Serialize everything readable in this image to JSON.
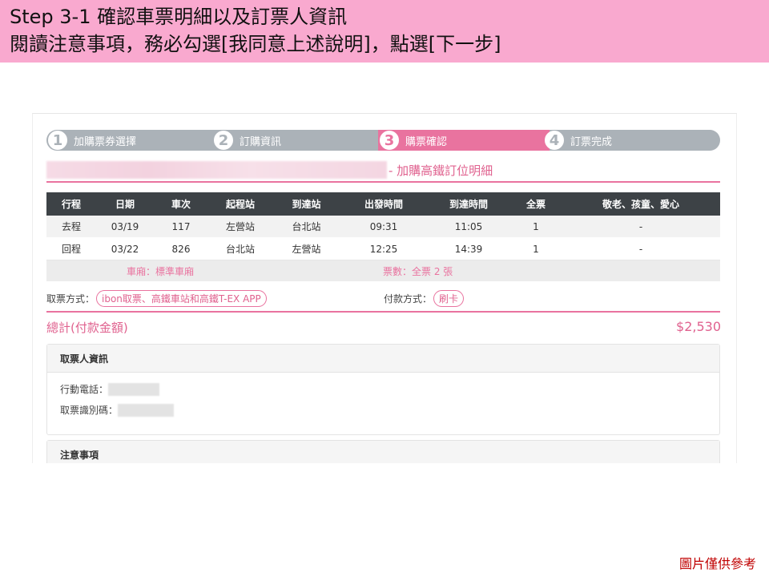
{
  "banner": {
    "line1": "Step 3-1 確認車票明細以及訂票人資訊",
    "line2": "閱讀注意事項，務必勾選[我同意上述說明]，點選[下一步]"
  },
  "stepper": [
    {
      "num": "1",
      "label": "加購票券選擇"
    },
    {
      "num": "2",
      "label": "訂購資訊"
    },
    {
      "num": "3",
      "label": "購票確認"
    },
    {
      "num": "4",
      "label": "訂票完成"
    }
  ],
  "section_title": "- 加購高鐵訂位明細",
  "table": {
    "headers": [
      "行程",
      "日期",
      "車次",
      "起程站",
      "到達站",
      "出發時間",
      "到達時間",
      "全票",
      "敬老、孩童、愛心"
    ],
    "rows": [
      [
        "去程",
        "03/19",
        "117",
        "左營站",
        "台北站",
        "09:31",
        "11:05",
        "1",
        "-"
      ],
      [
        "回程",
        "03/22",
        "826",
        "台北站",
        "左營站",
        "12:25",
        "14:39",
        "1",
        "-"
      ]
    ],
    "car_type": "車廂：標準車廂",
    "ticket_count": "票數：全票 2 張"
  },
  "pickup": {
    "label": "取票方式：",
    "value": "ibon取票、高鐵車站和高鐵T-EX APP"
  },
  "payment": {
    "label": "付款方式：",
    "value": "刷卡"
  },
  "total": {
    "label": "總計(付款金額)",
    "value": "$2,530"
  },
  "ticket_holder": {
    "title": "取票人資訊",
    "phone_label": "行動電話：",
    "id_label": "取票識別碼："
  },
  "notice": {
    "title": "注意事項"
  },
  "footer_note": "圖片僅供參考",
  "colors": {
    "banner": "#f9a9cf",
    "accent": "#e9739f",
    "stepper_gray": "#abb2b8",
    "table_head": "#3d4246"
  }
}
